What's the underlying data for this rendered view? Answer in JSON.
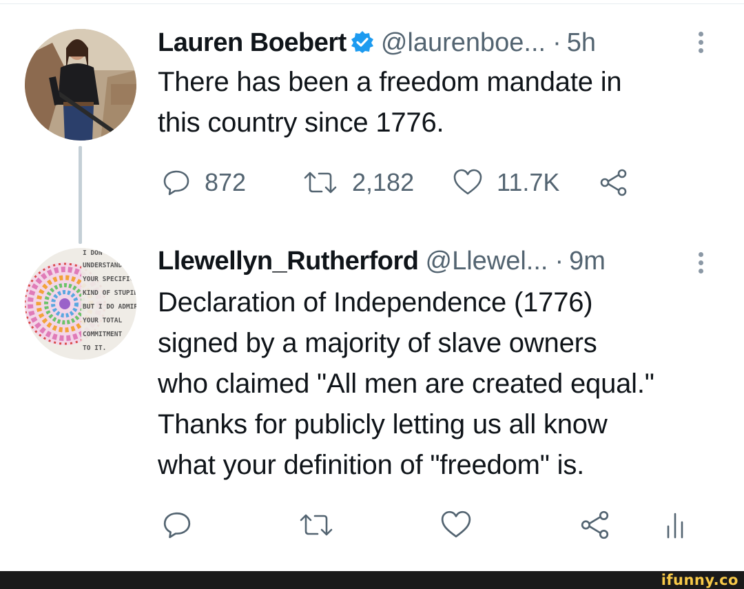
{
  "tweets": [
    {
      "name": "Lauren Boebert",
      "handle": "@laurenboe...",
      "separator": "·",
      "time": "5h",
      "text": "There has been a freedom mandate in\nthis country since 1776.",
      "stats": {
        "replies": "872",
        "retweets": "2,182",
        "likes": "11.7K"
      }
    },
    {
      "name": "Llewellyn_Rutherford",
      "handle": "@Llewel...",
      "separator": "·",
      "time": "9m",
      "text": "Declaration of Independence (1776)\nsigned by a majority of slave owners\nwho claimed \"All men are created equal.\"\nThanks for publicly letting us all know\nwhat your definition of \"freedom\" is.",
      "avatar_text": [
        "I DON'T",
        "UNDERSTAND",
        "YOUR SPECIFIC",
        "KIND OF STUPID",
        "BUT I DO ADMIRE",
        "YOUR TOTAL",
        "COMMITMENT",
        "TO IT."
      ]
    }
  ],
  "watermark": "ifunny.co",
  "colors": {
    "verified": "#1d9bf0",
    "secondary_text": "#536471",
    "thread_line": "#c4cfd6",
    "watermark": "#f7c948"
  }
}
